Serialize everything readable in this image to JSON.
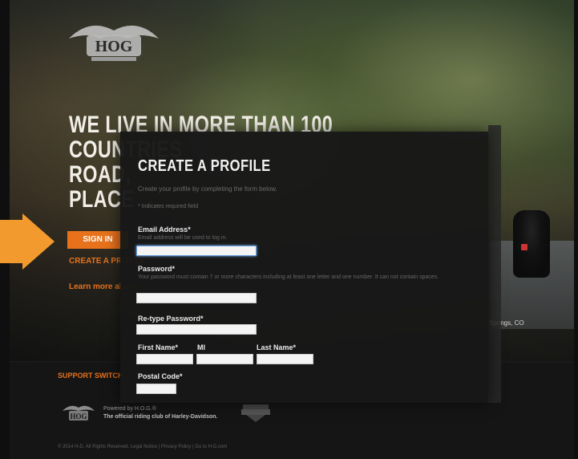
{
  "hero": {
    "lines": [
      "WE LIVE IN MORE THAN 100",
      "COUNTRIES",
      "ROAD,",
      "PLACE"
    ],
    "sign_in_label": "SIGN IN",
    "create_profile_link": "CREATE A PROFILE",
    "learn_more_link": "Learn more about",
    "location": "Springs, CO"
  },
  "modal": {
    "close_label": "×",
    "title": "CREATE A PROFILE",
    "intro": "Create your profile by completing the form below.",
    "required_note": "* Indicates required field",
    "email": {
      "label": "Email Address*",
      "hint": "Email address will be used to log in.",
      "value": ""
    },
    "password": {
      "label": "Password*",
      "hint": "Your password must contain 7 or more characters including at least one letter and one number. It can not contain spaces.",
      "value": ""
    },
    "retype_password": {
      "label": "Re-type Password*",
      "value": ""
    },
    "first_name": {
      "label": "First Name*",
      "value": ""
    },
    "mi": {
      "label": "MI",
      "value": ""
    },
    "last_name": {
      "label": "Last Name*",
      "value": ""
    },
    "postal_code": {
      "label": "Postal Code*",
      "value": ""
    }
  },
  "footer": {
    "nav": "SUPPORT   SWITCH",
    "powered_by": "Powered by H.O.G.®",
    "tagline": "The official riding club of Harley-Davidson.",
    "copyright": "© 2014 H-D. All Rights Reserved. Legal Notice | Privacy Policy | Go to H-D.com"
  },
  "colors": {
    "accent": "#e8721c",
    "modal_bg": "#181818"
  }
}
